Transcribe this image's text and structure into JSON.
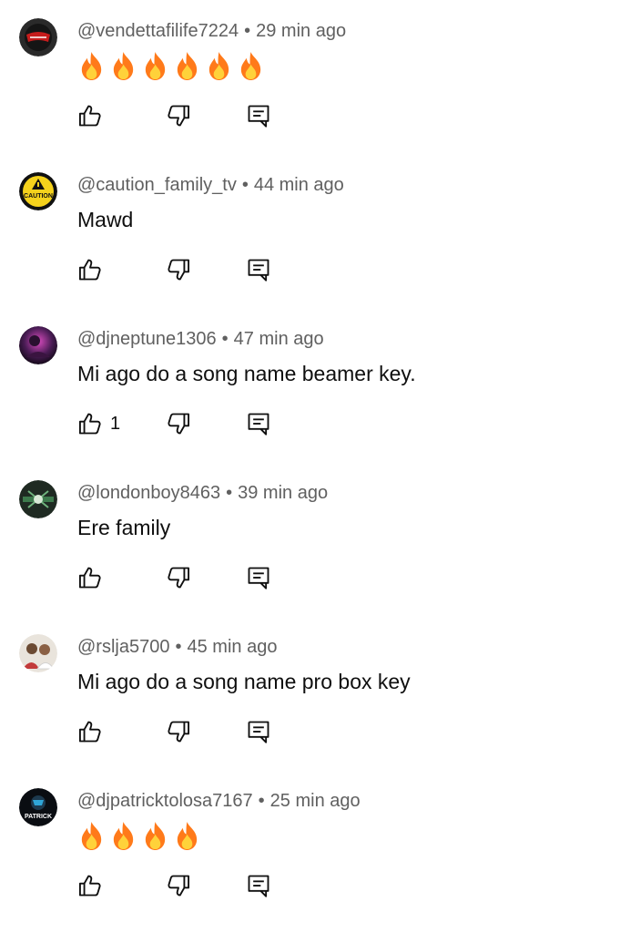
{
  "comments": [
    {
      "author": "@vendettafilife7224",
      "time": "29 min ago",
      "text": "",
      "emojis": [
        "🔥",
        "🔥",
        "🔥",
        "🔥",
        "🔥",
        "🔥"
      ],
      "likes": "",
      "avatar": "vendetta-avatar"
    },
    {
      "author": "@caution_family_tv",
      "time": "44 min ago",
      "text": "Mawd",
      "emojis": [],
      "likes": "",
      "avatar": "caution-avatar"
    },
    {
      "author": "@djneptune1306",
      "time": "47 min ago",
      "text": "Mi ago do a song name beamer key.",
      "emojis": [],
      "likes": "1",
      "avatar": "djneptune-avatar"
    },
    {
      "author": "@londonboy8463",
      "time": "39 min ago",
      "text": "Ere family",
      "emojis": [],
      "likes": "",
      "avatar": "londonboy-avatar"
    },
    {
      "author": "@rslja5700",
      "time": "45 min ago",
      "text": "Mi ago do a song name pro box key",
      "emojis": [],
      "likes": "",
      "avatar": "rslja-avatar"
    },
    {
      "author": "@djpatricktolosa7167",
      "time": "25 min ago",
      "text": "",
      "emojis": [
        "🔥",
        "🔥",
        "🔥",
        "🔥"
      ],
      "likes": "",
      "avatar": "djpatrick-avatar"
    }
  ],
  "separator": "•",
  "avatar_labels": {
    "caution": "CAUTION",
    "patrick": "PATRICK"
  },
  "colors": {
    "text": "#0f0f0f",
    "meta": "#606060",
    "fire_outer": "#ff7a1a",
    "fire_inner": "#ffd23a"
  }
}
